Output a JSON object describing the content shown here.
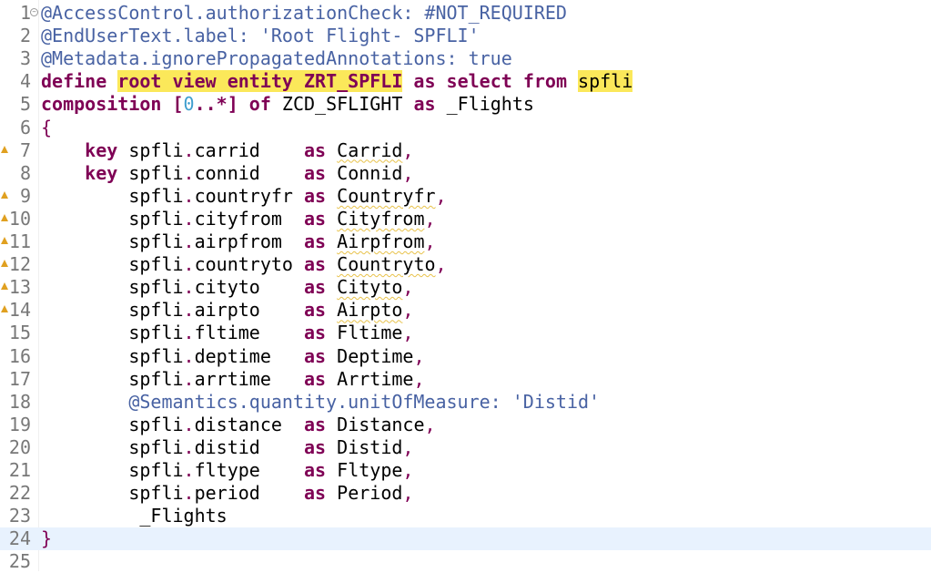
{
  "editor": {
    "current_line": 24,
    "warning_lines": [
      7,
      9,
      10,
      11,
      12,
      13,
      14
    ],
    "fold_lines": [
      1
    ],
    "lines": [
      [
        {
          "t": "@AccessControl.authorizationCheck: #NOT_REQUIRED",
          "c": "ann"
        }
      ],
      [
        {
          "t": "@EndUserText.label: 'Root Flight- SPFLI'",
          "c": "ann"
        }
      ],
      [
        {
          "t": "@Metadata.ignorePropagatedAnnotations: true",
          "c": "ann"
        }
      ],
      [
        {
          "t": "define",
          "c": "kw"
        },
        {
          "t": " ",
          "c": "plain"
        },
        {
          "t": "root view entity ZRT_SPFLI",
          "c": "kw hl"
        },
        {
          "t": " ",
          "c": "plain"
        },
        {
          "t": "as select from",
          "c": "kw"
        },
        {
          "t": " ",
          "c": "plain"
        },
        {
          "t": "spfli",
          "c": "plain hl"
        }
      ],
      [
        {
          "t": "composition [",
          "c": "kw"
        },
        {
          "t": "0",
          "c": "num"
        },
        {
          "t": "..*] of",
          "c": "kw"
        },
        {
          "t": " ZCD_SFLIGHT ",
          "c": "plain"
        },
        {
          "t": "as",
          "c": "kw"
        },
        {
          "t": " _Flights",
          "c": "plain"
        }
      ],
      [
        {
          "t": "{",
          "c": "kwn"
        }
      ],
      [
        {
          "t": "    key",
          "c": "kw"
        },
        {
          "t": " spfli",
          "c": "plain"
        },
        {
          "t": ".",
          "c": "dot"
        },
        {
          "t": "carrid    ",
          "c": "plain"
        },
        {
          "t": "as",
          "c": "kw"
        },
        {
          "t": " ",
          "c": "plain"
        },
        {
          "t": "Carrid",
          "c": "plain sq"
        },
        {
          "t": ",",
          "c": "dot"
        }
      ],
      [
        {
          "t": "    key",
          "c": "kw"
        },
        {
          "t": " spfli",
          "c": "plain"
        },
        {
          "t": ".",
          "c": "dot"
        },
        {
          "t": "connid    ",
          "c": "plain"
        },
        {
          "t": "as",
          "c": "kw"
        },
        {
          "t": " Connid",
          "c": "plain"
        },
        {
          "t": ",",
          "c": "dot"
        }
      ],
      [
        {
          "t": "        spfli",
          "c": "plain"
        },
        {
          "t": ".",
          "c": "dot"
        },
        {
          "t": "countryfr ",
          "c": "plain"
        },
        {
          "t": "as",
          "c": "kw"
        },
        {
          "t": " ",
          "c": "plain"
        },
        {
          "t": "Countryfr",
          "c": "plain sq"
        },
        {
          "t": ",",
          "c": "dot"
        }
      ],
      [
        {
          "t": "        spfli",
          "c": "plain"
        },
        {
          "t": ".",
          "c": "dot"
        },
        {
          "t": "cityfrom  ",
          "c": "plain"
        },
        {
          "t": "as",
          "c": "kw"
        },
        {
          "t": " ",
          "c": "plain"
        },
        {
          "t": "Cityfrom",
          "c": "plain sq"
        },
        {
          "t": ",",
          "c": "dot"
        }
      ],
      [
        {
          "t": "        spfli",
          "c": "plain"
        },
        {
          "t": ".",
          "c": "dot"
        },
        {
          "t": "airpfrom  ",
          "c": "plain"
        },
        {
          "t": "as",
          "c": "kw"
        },
        {
          "t": " ",
          "c": "plain"
        },
        {
          "t": "Airpfrom",
          "c": "plain sq"
        },
        {
          "t": ",",
          "c": "dot"
        }
      ],
      [
        {
          "t": "        spfli",
          "c": "plain"
        },
        {
          "t": ".",
          "c": "dot"
        },
        {
          "t": "countryto ",
          "c": "plain"
        },
        {
          "t": "as",
          "c": "kw"
        },
        {
          "t": " ",
          "c": "plain"
        },
        {
          "t": "Countryto",
          "c": "plain sq"
        },
        {
          "t": ",",
          "c": "dot"
        }
      ],
      [
        {
          "t": "        spfli",
          "c": "plain"
        },
        {
          "t": ".",
          "c": "dot"
        },
        {
          "t": "cityto    ",
          "c": "plain"
        },
        {
          "t": "as",
          "c": "kw"
        },
        {
          "t": " ",
          "c": "plain"
        },
        {
          "t": "Cityto",
          "c": "plain sq"
        },
        {
          "t": ",",
          "c": "dot"
        }
      ],
      [
        {
          "t": "        spfli",
          "c": "plain"
        },
        {
          "t": ".",
          "c": "dot"
        },
        {
          "t": "airpto    ",
          "c": "plain"
        },
        {
          "t": "as",
          "c": "kw"
        },
        {
          "t": " ",
          "c": "plain"
        },
        {
          "t": "Airpto",
          "c": "plain sq"
        },
        {
          "t": ",",
          "c": "dot"
        }
      ],
      [
        {
          "t": "        spfli",
          "c": "plain"
        },
        {
          "t": ".",
          "c": "dot"
        },
        {
          "t": "fltime    ",
          "c": "plain"
        },
        {
          "t": "as",
          "c": "kw"
        },
        {
          "t": " Fltime",
          "c": "plain"
        },
        {
          "t": ",",
          "c": "dot"
        }
      ],
      [
        {
          "t": "        spfli",
          "c": "plain"
        },
        {
          "t": ".",
          "c": "dot"
        },
        {
          "t": "deptime   ",
          "c": "plain"
        },
        {
          "t": "as",
          "c": "kw"
        },
        {
          "t": " Deptime",
          "c": "plain"
        },
        {
          "t": ",",
          "c": "dot"
        }
      ],
      [
        {
          "t": "        spfli",
          "c": "plain"
        },
        {
          "t": ".",
          "c": "dot"
        },
        {
          "t": "arrtime   ",
          "c": "plain"
        },
        {
          "t": "as",
          "c": "kw"
        },
        {
          "t": " Arrtime",
          "c": "plain"
        },
        {
          "t": ",",
          "c": "dot"
        }
      ],
      [
        {
          "t": "        @Semantics.quantity.unitOfMeasure: 'Distid'",
          "c": "ann"
        }
      ],
      [
        {
          "t": "        spfli",
          "c": "plain"
        },
        {
          "t": ".",
          "c": "dot"
        },
        {
          "t": "distance  ",
          "c": "plain"
        },
        {
          "t": "as",
          "c": "kw"
        },
        {
          "t": " Distance",
          "c": "plain"
        },
        {
          "t": ",",
          "c": "dot"
        }
      ],
      [
        {
          "t": "        spfli",
          "c": "plain"
        },
        {
          "t": ".",
          "c": "dot"
        },
        {
          "t": "distid    ",
          "c": "plain"
        },
        {
          "t": "as",
          "c": "kw"
        },
        {
          "t": " Distid",
          "c": "plain"
        },
        {
          "t": ",",
          "c": "dot"
        }
      ],
      [
        {
          "t": "        spfli",
          "c": "plain"
        },
        {
          "t": ".",
          "c": "dot"
        },
        {
          "t": "fltype    ",
          "c": "plain"
        },
        {
          "t": "as",
          "c": "kw"
        },
        {
          "t": " Fltype",
          "c": "plain"
        },
        {
          "t": ",",
          "c": "dot"
        }
      ],
      [
        {
          "t": "        spfli",
          "c": "plain"
        },
        {
          "t": ".",
          "c": "dot"
        },
        {
          "t": "period    ",
          "c": "plain"
        },
        {
          "t": "as",
          "c": "kw"
        },
        {
          "t": " Period",
          "c": "plain"
        },
        {
          "t": ",",
          "c": "dot"
        }
      ],
      [
        {
          "t": "         _Flights",
          "c": "plain"
        }
      ],
      [
        {
          "t": "}",
          "c": "kwn"
        }
      ],
      []
    ]
  }
}
